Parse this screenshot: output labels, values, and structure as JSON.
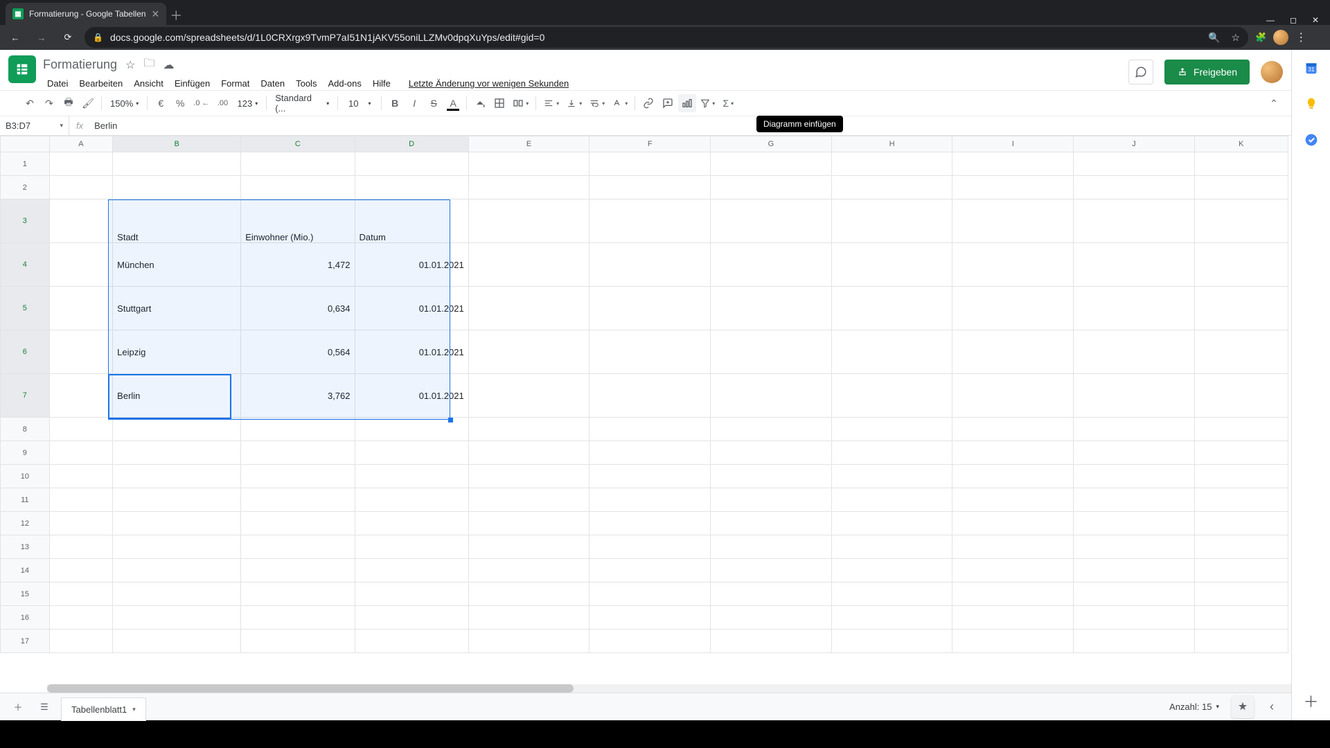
{
  "browser": {
    "tab_title": "Formatierung - Google Tabellen",
    "url": "docs.google.com/spreadsheets/d/1L0CRXrgx9TvmP7aI51N1jAKV55oniLLZMv0dpqXuYps/edit#gid=0"
  },
  "doc": {
    "name": "Formatierung",
    "last_edit": "Letzte Änderung vor wenigen Sekunden",
    "share_label": "Freigeben"
  },
  "menus": {
    "file": "Datei",
    "edit": "Bearbeiten",
    "view": "Ansicht",
    "insert": "Einfügen",
    "format": "Format",
    "data": "Daten",
    "tools": "Tools",
    "addons": "Add-ons",
    "help": "Hilfe"
  },
  "toolbar": {
    "zoom": "150%",
    "currency": "€",
    "percent": "%",
    "dec_dec": ".0",
    "inc_dec": ".00",
    "num_format": "123",
    "font": "Standard (...",
    "font_size": "10",
    "tooltip": "Diagramm einfügen"
  },
  "formula_bar": {
    "range": "B3:D7",
    "value": "Berlin"
  },
  "columns": [
    "A",
    "B",
    "C",
    "D",
    "E",
    "F",
    "G",
    "H",
    "I",
    "J",
    "K"
  ],
  "selected_cols": [
    "B",
    "C",
    "D"
  ],
  "selected_rows": [
    3,
    4,
    5,
    6,
    7
  ],
  "row_numbers": [
    1,
    2,
    3,
    4,
    5,
    6,
    7,
    8,
    9,
    10,
    11,
    12,
    13,
    14,
    15,
    16,
    17
  ],
  "table": {
    "headers": {
      "b": "Stadt",
      "c": "Einwohner (Mio.)",
      "d": "Datum"
    },
    "rows": [
      {
        "b": "München",
        "c": "1,472",
        "d": "01.01.2021"
      },
      {
        "b": "Stuttgart",
        "c": "0,634",
        "d": "01.01.2021"
      },
      {
        "b": "Leipzig",
        "c": "0,564",
        "d": "01.01.2021"
      },
      {
        "b": "Berlin",
        "c": "3,762",
        "d": "01.01.2021"
      }
    ]
  },
  "sheetbar": {
    "tab_name": "Tabellenblatt1",
    "count_label": "Anzahl: 15"
  }
}
